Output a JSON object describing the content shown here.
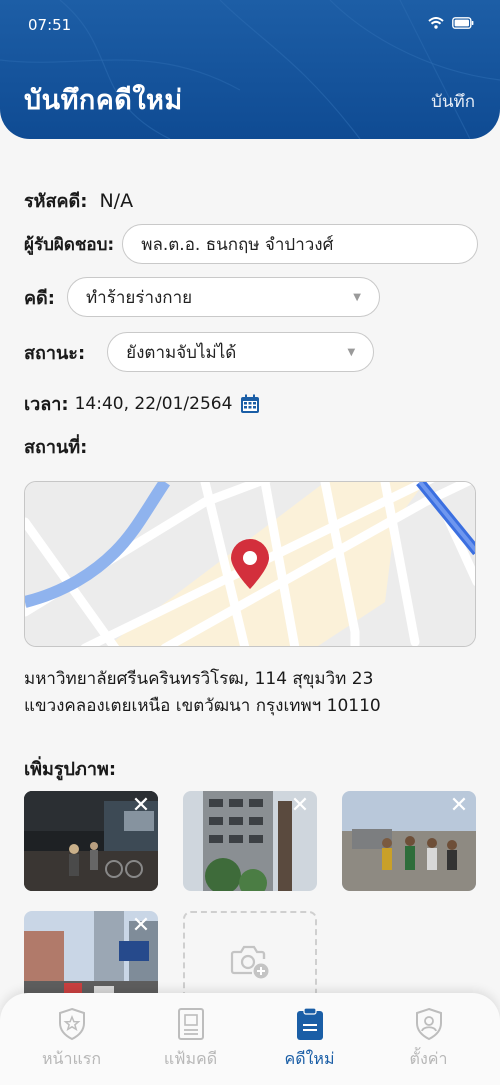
{
  "status_bar": {
    "time": "07:51"
  },
  "header": {
    "title": "บันทึกคดีใหม่",
    "save_label": "บันทึก"
  },
  "form": {
    "case_id_label": "รหัสคดี:",
    "case_id_value": "N/A",
    "responsible_label": "ผู้รับผิดชอบ:",
    "responsible_value": "พล.ต.อ. ธนกฤษ จำปาวงศ์",
    "case_type_label": "คดี:",
    "case_type_value": "ทำร้ายร่างกาย",
    "status_label": "สถานะ:",
    "status_value": "ยังตามจับไม่ได้",
    "time_label": "เวลา:",
    "time_value": "14:40, 22/01/2564",
    "location_label": "สถานที่:"
  },
  "address": {
    "line1": "มหาวิทยาลัยศรีนครินทรวิโรฒ, 114 สุขุมวิท 23",
    "line2": "แขวงคลองเตยเหนือ เขตวัฒนา กรุงเทพฯ 10110"
  },
  "photos": {
    "label": "เพิ่มรูปภาพ:",
    "close_glyph": "✕"
  },
  "tabs": [
    {
      "label": "หน้าแรก",
      "icon": "shield-star-icon"
    },
    {
      "label": "แฟ้มคดี",
      "icon": "case-file-icon"
    },
    {
      "label": "คดีใหม่",
      "icon": "new-case-clipboard-icon"
    },
    {
      "label": "ตั้งค่า",
      "icon": "settings-user-shield-icon"
    }
  ],
  "colors": {
    "primary": "#1a5ea6",
    "pin": "#d32f3c",
    "map_road_blue": "#5b8fe8",
    "tab_inactive": "#b7b7b7"
  }
}
